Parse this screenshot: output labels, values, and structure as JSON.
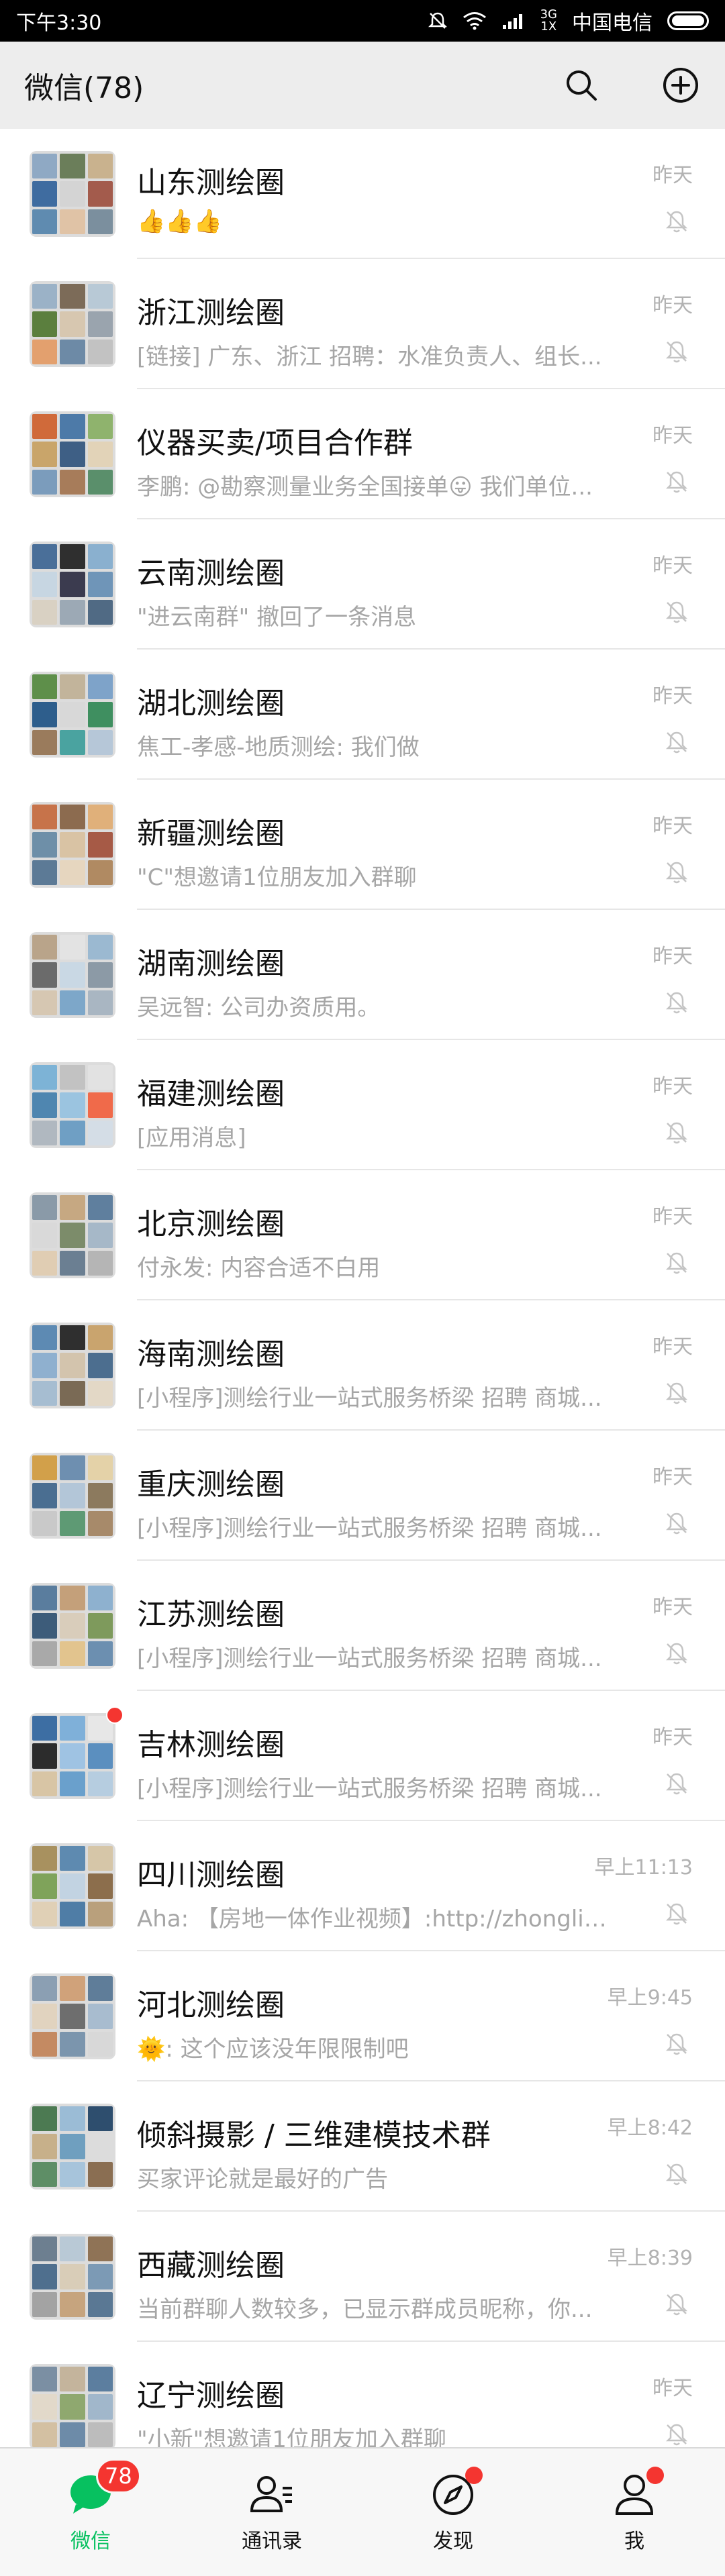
{
  "status_bar": {
    "time": "下午3:30",
    "network": "3G",
    "network_sub": "1X",
    "carrier": "中国电信"
  },
  "header": {
    "title": "微信(78)",
    "search_icon": "search-icon",
    "add_icon": "plus-circle-icon"
  },
  "chats": [
    {
      "name": "山东测绘圈",
      "time": "昨天",
      "preview": "👍👍👍",
      "muted": true,
      "dot": false,
      "colors": [
        "#8fa9c4",
        "#6b7e5a",
        "#c9b28e",
        "#3f6ca0",
        "#d4d4d4",
        "#a35b4c",
        "#5f8bb0",
        "#e0c3a6",
        "#7b8f9e"
      ]
    },
    {
      "name": "浙江测绘圈",
      "time": "昨天",
      "preview": "[链接] 广东、浙江 招聘：水准负责人、组长...",
      "muted": true,
      "dot": false,
      "colors": [
        "#9bb2c7",
        "#7c6b58",
        "#b8c9d6",
        "#5b7f3e",
        "#d7c7b0",
        "#9aa4ae",
        "#e3a06e",
        "#6d8aa6",
        "#c2c2c2"
      ]
    },
    {
      "name": "仪器买卖/项目合作群",
      "time": "昨天",
      "preview": "李鹏: @勘察测量业务全国接单😛 我们单位...",
      "muted": true,
      "dot": false,
      "colors": [
        "#d06a3a",
        "#4d7aa8",
        "#8fb36d",
        "#c9a56a",
        "#3e5f85",
        "#e2d3b8",
        "#7b9cbc",
        "#a77c5a",
        "#5a8f6b"
      ]
    },
    {
      "name": "云南测绘圈",
      "time": "昨天",
      "preview": "\"进云南群\" 撤回了一条消息",
      "muted": true,
      "dot": false,
      "colors": [
        "#4a6f99",
        "#2f2f2f",
        "#8ab0cf",
        "#c7d6e2",
        "#3b3b4f",
        "#6f95b8",
        "#d9d1c3",
        "#9ca9b5",
        "#506a84"
      ]
    },
    {
      "name": "湖北测绘圈",
      "time": "昨天",
      "preview": "焦工-孝感-地质测绘: 我们做",
      "muted": true,
      "dot": false,
      "colors": [
        "#5e8f4a",
        "#c2b49b",
        "#7ea3c9",
        "#2e5e8c",
        "#d8d8d8",
        "#3f8f60",
        "#9a7b5c",
        "#4aa3a0",
        "#b6c7d8"
      ]
    },
    {
      "name": "新疆测绘圈",
      "time": "昨天",
      "preview": "\"C\"想邀请1位朋友加入群聊",
      "muted": true,
      "dot": false,
      "colors": [
        "#c7734a",
        "#8c6b4f",
        "#e0b07a",
        "#6e8fa8",
        "#d9c3a4",
        "#a65a46",
        "#5c7a96",
        "#e6d6bf",
        "#b08a62"
      ]
    },
    {
      "name": "湖南测绘圈",
      "time": "昨天",
      "preview": "吴远智: 公司办资质用。",
      "muted": true,
      "dot": false,
      "colors": [
        "#b9a48a",
        "#e3e3e3",
        "#9bb9d1",
        "#6b6b6b",
        "#c9d8e4",
        "#8c9aa6",
        "#d6c7b2",
        "#7da7c9",
        "#a9b6c2"
      ]
    },
    {
      "name": "福建测绘圈",
      "time": "昨天",
      "preview": "[应用消息]",
      "muted": true,
      "dot": false,
      "colors": [
        "#7db3d6",
        "#c2c2c2",
        "#e2e2e2",
        "#4f86b0",
        "#9bc4e0",
        "#f06a4a",
        "#b0b8c0",
        "#6f9fc4",
        "#d4dde6"
      ]
    },
    {
      "name": "北京测绘圈",
      "time": "昨天",
      "preview": "付永发: 内容合适不白用",
      "muted": true,
      "dot": false,
      "colors": [
        "#8a9aa8",
        "#c6a882",
        "#5f7f9e",
        "#d9d9d9",
        "#7c8c6a",
        "#a6b8c8",
        "#e0cdb3",
        "#6b7f92",
        "#b5b5b5"
      ]
    },
    {
      "name": "海南测绘圈",
      "time": "昨天",
      "preview": "[小程序]测绘行业一站式服务桥梁 招聘 商城...",
      "muted": true,
      "dot": false,
      "colors": [
        "#5d8ab3",
        "#2f2f2f",
        "#c9a46e",
        "#8fb0cf",
        "#d3c4ad",
        "#4c6e8f",
        "#a6bdd1",
        "#7a6a55",
        "#e3d8c6"
      ]
    },
    {
      "name": "重庆测绘圈",
      "time": "昨天",
      "preview": "[小程序]测绘行业一站式服务桥梁 招聘 商城...",
      "muted": true,
      "dot": false,
      "colors": [
        "#d2a04a",
        "#6e8fb0",
        "#e4d2a8",
        "#4a6e91",
        "#b3c6d8",
        "#8c7a5e",
        "#c9c9c9",
        "#5e9a74",
        "#a78a6a"
      ]
    },
    {
      "name": "江苏测绘圈",
      "time": "昨天",
      "preview": "[小程序]测绘行业一站式服务桥梁 招聘 商城...",
      "muted": true,
      "dot": false,
      "colors": [
        "#5a7d9e",
        "#c4a07a",
        "#8eb1cf",
        "#3d5c7a",
        "#d9cdbb",
        "#7e9a5c",
        "#a9a9a9",
        "#e2c48e",
        "#6c8fb0"
      ]
    },
    {
      "name": "吉林测绘圈",
      "time": "昨天",
      "preview": "[小程序]测绘行业一站式服务桥梁 招聘 商城...",
      "muted": true,
      "dot": true,
      "colors": [
        "#3d6ea3",
        "#7fb0d9",
        "#e7e7e7",
        "#2c2c2c",
        "#9fc3e3",
        "#5b8fbf",
        "#d8c5a5",
        "#6aa0cc",
        "#b6cde0"
      ]
    },
    {
      "name": "四川测绘圈",
      "time": "早上11:13",
      "preview": "Aha: 【房地一体作业视频】:http://zhongliuk...",
      "muted": true,
      "dot": false,
      "colors": [
        "#a8915f",
        "#5e8ab0",
        "#d6c6a8",
        "#7fa35a",
        "#c2d3e2",
        "#8c6e4c",
        "#e0d0b6",
        "#4f7da6",
        "#b9a07c"
      ]
    },
    {
      "name": "河北测绘圈",
      "time": "早上9:45",
      "preview": "🌞: 这个应该没年限限制吧",
      "muted": true,
      "dot": false,
      "colors": [
        "#8b9fb3",
        "#d0a27a",
        "#5f7d99",
        "#e1d3bf",
        "#6e6e6e",
        "#a8bccf",
        "#c48a62",
        "#7b95ad",
        "#d8d8d8"
      ]
    },
    {
      "name": "倾斜摄影 / 三维建模技术群",
      "time": "早上8:42",
      "preview": "买家评论就是最好的广告",
      "muted": true,
      "dot": false,
      "colors": [
        "#4c7a52",
        "#9bbcd6",
        "#2e4e6e",
        "#c7b08a",
        "#6f9fbf",
        "#dcdcdc",
        "#5e8e66",
        "#a7c4db",
        "#8a6e52"
      ]
    },
    {
      "name": "西藏测绘圈",
      "time": "早上8:39",
      "preview": "当前群聊人数较多，已显示群成员昵称，你...",
      "muted": true,
      "dot": false,
      "colors": [
        "#6d7f90",
        "#b9c9d6",
        "#8f7356",
        "#4f6f8e",
        "#d9cdb8",
        "#7c9ab5",
        "#a3a3a3",
        "#c6a47e",
        "#5a7894"
      ]
    },
    {
      "name": "辽宁测绘圈",
      "time": "昨天",
      "preview": "\"小新\"想邀请1位朋友加入群聊",
      "muted": true,
      "dot": false,
      "colors": [
        "#7b8fa3",
        "#c4b49c",
        "#5c7e9f",
        "#e2d9ca",
        "#8fa86f",
        "#a1b7cb",
        "#d3c0a2",
        "#6d8ba8",
        "#bcbcbc"
      ]
    }
  ],
  "tabs": [
    {
      "label": "微信",
      "icon": "chat-bubble-icon",
      "badge": "78",
      "dot": false,
      "active": true
    },
    {
      "label": "通讯录",
      "icon": "contacts-icon",
      "badge": "",
      "dot": false,
      "active": false
    },
    {
      "label": "发现",
      "icon": "compass-icon",
      "badge": "",
      "dot": true,
      "active": false
    },
    {
      "label": "我",
      "icon": "person-icon",
      "badge": "",
      "dot": true,
      "active": false
    }
  ],
  "colors": {
    "accent": "#07c160",
    "badge_red": "#f43530",
    "background": "#ededed"
  }
}
